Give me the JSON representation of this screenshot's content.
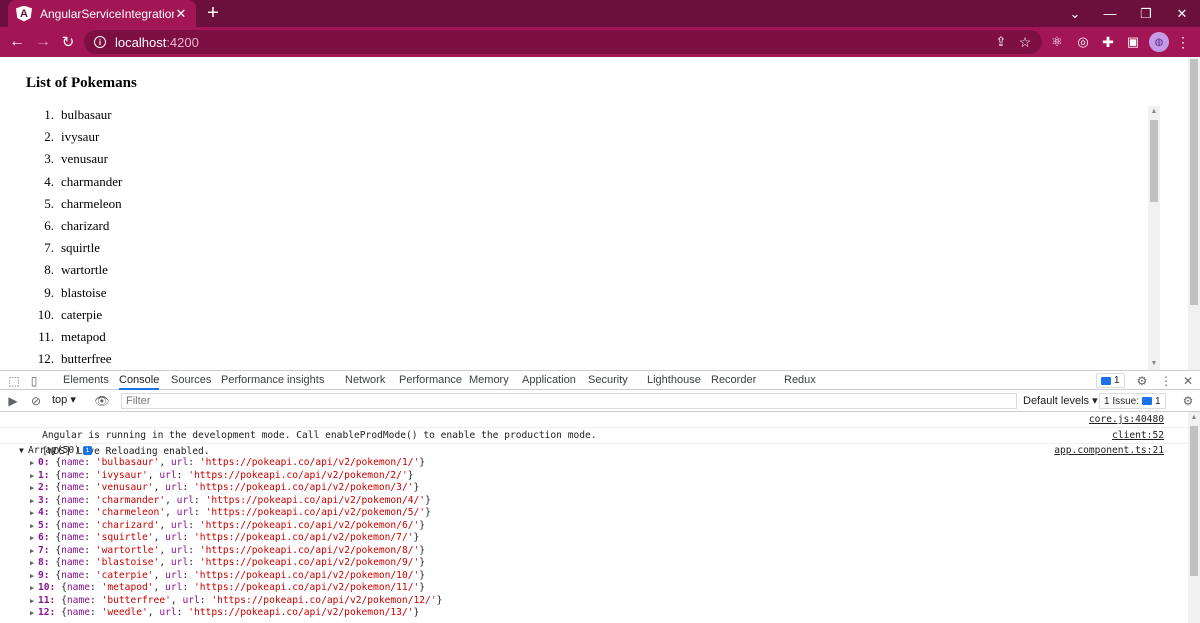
{
  "browser": {
    "tab_title": "AngularServiceIntegration",
    "tab_favicon": "A",
    "url_host": "localhost",
    "url_port": ":4200",
    "accent_color": "#a31656"
  },
  "page": {
    "heading": "List of Pokemans",
    "items": [
      {
        "num": "1.",
        "name": "bulbasaur"
      },
      {
        "num": "2.",
        "name": "ivysaur"
      },
      {
        "num": "3.",
        "name": "venusaur"
      },
      {
        "num": "4.",
        "name": "charmander"
      },
      {
        "num": "5.",
        "name": "charmeleon"
      },
      {
        "num": "6.",
        "name": "charizard"
      },
      {
        "num": "7.",
        "name": "squirtle"
      },
      {
        "num": "8.",
        "name": "wartortle"
      },
      {
        "num": "9.",
        "name": "blastoise"
      },
      {
        "num": "10.",
        "name": "caterpie"
      },
      {
        "num": "11.",
        "name": "metapod"
      },
      {
        "num": "12.",
        "name": "butterfree"
      }
    ]
  },
  "devtools": {
    "tabs": [
      "Elements",
      "Console",
      "Sources",
      "Performance insights",
      "Network",
      "Performance",
      "Memory",
      "Application",
      "Security",
      "Lighthouse",
      "Recorder",
      "Redux"
    ],
    "active_tab": "Console",
    "messages_count": "1",
    "context": "top",
    "filter_placeholder": "Filter",
    "levels": "Default levels",
    "issues_label": "1 Issue:",
    "issues_count": "1"
  },
  "console": {
    "lines": [
      {
        "text": "Angular is running in the development mode. Call enableProdMode() to enable the production mode.",
        "source": "core.js:40480"
      },
      {
        "text": "[WDS] Live Reloading enabled.",
        "source": "client:52"
      }
    ],
    "array_label": "Array(50)",
    "array_source": "app.component.ts:21",
    "array_items": [
      {
        "idx": "0:",
        "name": "'bulbasaur'",
        "url": "'https://pokeapi.co/api/v2/pokemon/1/'"
      },
      {
        "idx": "1:",
        "name": "'ivysaur'",
        "url": "'https://pokeapi.co/api/v2/pokemon/2/'"
      },
      {
        "idx": "2:",
        "name": "'venusaur'",
        "url": "'https://pokeapi.co/api/v2/pokemon/3/'"
      },
      {
        "idx": "3:",
        "name": "'charmander'",
        "url": "'https://pokeapi.co/api/v2/pokemon/4/'"
      },
      {
        "idx": "4:",
        "name": "'charmeleon'",
        "url": "'https://pokeapi.co/api/v2/pokemon/5/'"
      },
      {
        "idx": "5:",
        "name": "'charizard'",
        "url": "'https://pokeapi.co/api/v2/pokemon/6/'"
      },
      {
        "idx": "6:",
        "name": "'squirtle'",
        "url": "'https://pokeapi.co/api/v2/pokemon/7/'"
      },
      {
        "idx": "7:",
        "name": "'wartortle'",
        "url": "'https://pokeapi.co/api/v2/pokemon/8/'"
      },
      {
        "idx": "8:",
        "name": "'blastoise'",
        "url": "'https://pokeapi.co/api/v2/pokemon/9/'"
      },
      {
        "idx": "9:",
        "name": "'caterpie'",
        "url": "'https://pokeapi.co/api/v2/pokemon/10/'"
      },
      {
        "idx": "10:",
        "name": "'metapod'",
        "url": "'https://pokeapi.co/api/v2/pokemon/11/'"
      },
      {
        "idx": "11:",
        "name": "'butterfree'",
        "url": "'https://pokeapi.co/api/v2/pokemon/12/'"
      },
      {
        "idx": "12:",
        "name": "'weedle'",
        "url": "'https://pokeapi.co/api/v2/pokemon/13/'"
      }
    ]
  }
}
